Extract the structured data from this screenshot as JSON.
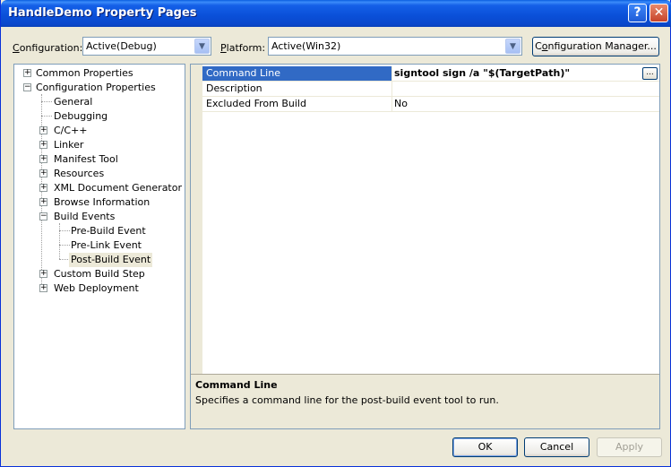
{
  "window": {
    "title": "HandleDemo Property Pages",
    "help_glyph": "?",
    "close_glyph": "✕"
  },
  "toolbar": {
    "configuration_label_u": "C",
    "configuration_label_rest": "onfiguration:",
    "configuration_value": "Active(Debug)",
    "platform_label_u": "P",
    "platform_label_rest": "latform:",
    "platform_value": "Active(Win32)",
    "config_manager_prefix": "C",
    "config_manager_u": "o",
    "config_manager_rest": "nfiguration Manager...",
    "dropdown_glyph": "▼"
  },
  "tree": {
    "collapse_glyph": "−",
    "expand_glyph": "+",
    "items": [
      "Common Properties",
      "Configuration Properties",
      "General",
      "Debugging",
      "C/C++",
      "Linker",
      "Manifest Tool",
      "Resources",
      "XML Document Generator",
      "Browse Information",
      "Build Events",
      "Pre-Build Event",
      "Pre-Link Event",
      "Post-Build Event",
      "Custom Build Step",
      "Web Deployment"
    ]
  },
  "grid": {
    "rows": [
      {
        "name": "Command Line",
        "value": "signtool sign /a \"$(TargetPath)\""
      },
      {
        "name": "Description",
        "value": ""
      },
      {
        "name": "Excluded From Build",
        "value": "No"
      }
    ],
    "ellipsis": "..."
  },
  "description": {
    "title": "Command Line",
    "text": "Specifies a command line for the post-build event tool to run."
  },
  "buttons": {
    "ok": "OK",
    "cancel": "Cancel",
    "apply": "Apply"
  },
  "colors": {
    "selection": "#316AC5",
    "face": "#ECE9D8",
    "border": "#7F9DB9"
  }
}
